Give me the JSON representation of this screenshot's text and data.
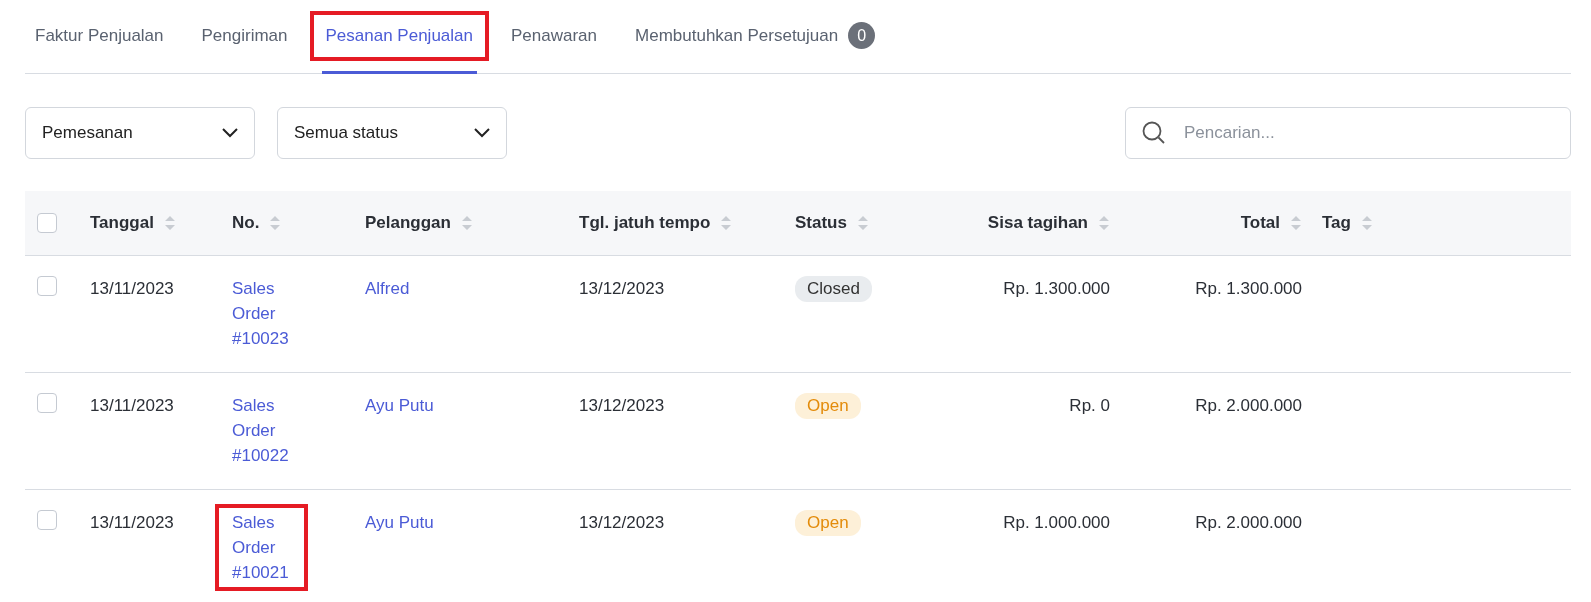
{
  "tabs": [
    {
      "label": "Faktur Penjualan",
      "selected": false,
      "highlighted": false
    },
    {
      "label": "Pengiriman",
      "selected": false,
      "highlighted": false
    },
    {
      "label": "Pesanan Penjualan",
      "selected": true,
      "highlighted": true
    },
    {
      "label": "Penawaran",
      "selected": false,
      "highlighted": false
    },
    {
      "label": "Membutuhkan Persetujuan",
      "selected": false,
      "highlighted": false,
      "badge": "0"
    }
  ],
  "filters": [
    {
      "value": "Pemesanan"
    },
    {
      "value": "Semua status"
    }
  ],
  "search": {
    "placeholder": "Pencarian..."
  },
  "table": {
    "select_all": {
      "checked": false
    },
    "columns": [
      {
        "label": "Tanggal"
      },
      {
        "label": "No."
      },
      {
        "label": "Pelanggan"
      },
      {
        "label": "Tgl. jatuh tempo"
      },
      {
        "label": "Status"
      },
      {
        "label": "Sisa tagihan"
      },
      {
        "label": "Total"
      },
      {
        "label": "Tag"
      }
    ],
    "rows": [
      {
        "checked": false,
        "date": "13/11/2023",
        "number": "Sales Order #10023",
        "number_highlighted": false,
        "customer": "Alfred",
        "due": "13/12/2023",
        "status": "Closed",
        "kind": "closed",
        "remaining": "Rp. 1.300.000",
        "total": "Rp. 1.300.000"
      },
      {
        "checked": false,
        "date": "13/11/2023",
        "number": "Sales Order #10022",
        "number_highlighted": false,
        "customer": "Ayu Putu",
        "due": "13/12/2023",
        "status": "Open",
        "kind": "open",
        "remaining": "Rp. 0",
        "total": "Rp. 2.000.000"
      },
      {
        "checked": false,
        "date": "13/11/2023",
        "number": "Sales Order #10021",
        "number_highlighted": true,
        "customer": "Ayu Putu",
        "due": "13/12/2023",
        "status": "Open",
        "kind": "open",
        "remaining": "Rp. 1.000.000",
        "total": "Rp. 2.000.000"
      }
    ]
  }
}
